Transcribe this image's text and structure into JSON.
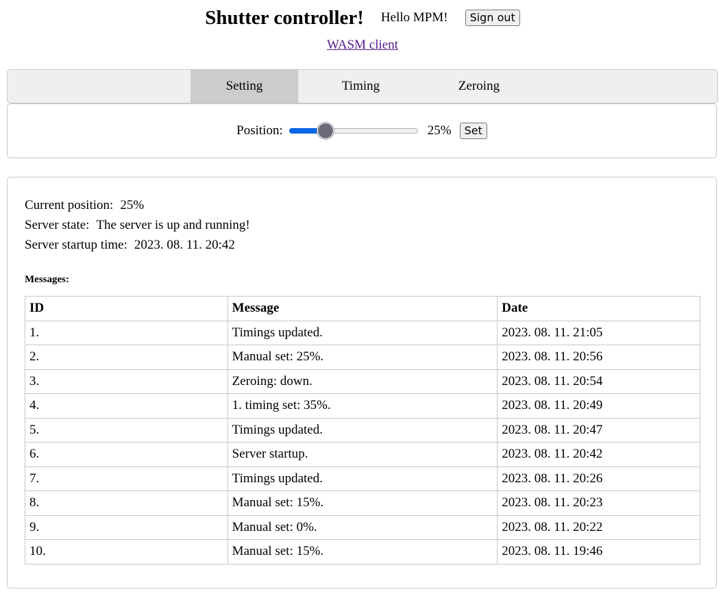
{
  "header": {
    "title": "Shutter controller!",
    "greeting": "Hello MPM!",
    "sign_out_label": "Sign out"
  },
  "wasm_link": "WASM client",
  "tabs": [
    {
      "label": "Setting",
      "active": true
    },
    {
      "label": "Timing",
      "active": false
    },
    {
      "label": "Zeroing",
      "active": false
    }
  ],
  "position": {
    "label": "Position:",
    "value_percent": 25,
    "value_text": "25%",
    "set_label": "Set"
  },
  "colors": {
    "slider_fill": "#0b66e4",
    "slider_thumb": "#6a6a78",
    "link": "#551a8b",
    "active_tab": "#cccccc"
  },
  "info": {
    "current_position_label": "Current position:",
    "current_position_value": "25%",
    "server_state_label": "Server state:",
    "server_state_value": "The server is up and running!",
    "startup_label": "Server startup time:",
    "startup_value": "2023. 08. 11. 20:42"
  },
  "messages": {
    "heading": "Messages:",
    "columns": [
      "ID",
      "Message",
      "Date"
    ],
    "rows": [
      {
        "id": "1.",
        "message": "Timings updated.",
        "date": "2023. 08. 11. 21:05"
      },
      {
        "id": "2.",
        "message": "Manual set: 25%.",
        "date": "2023. 08. 11. 20:56"
      },
      {
        "id": "3.",
        "message": "Zeroing: down.",
        "date": "2023. 08. 11. 20:54"
      },
      {
        "id": "4.",
        "message": "1. timing set: 35%.",
        "date": "2023. 08. 11. 20:49"
      },
      {
        "id": "5.",
        "message": "Timings updated.",
        "date": "2023. 08. 11. 20:47"
      },
      {
        "id": "6.",
        "message": "Server startup.",
        "date": "2023. 08. 11. 20:42"
      },
      {
        "id": "7.",
        "message": "Timings updated.",
        "date": "2023. 08. 11. 20:26"
      },
      {
        "id": "8.",
        "message": "Manual set: 15%.",
        "date": "2023. 08. 11. 20:23"
      },
      {
        "id": "9.",
        "message": "Manual set: 0%.",
        "date": "2023. 08. 11. 20:22"
      },
      {
        "id": "10.",
        "message": "Manual set: 15%.",
        "date": "2023. 08. 11. 19:46"
      }
    ]
  }
}
